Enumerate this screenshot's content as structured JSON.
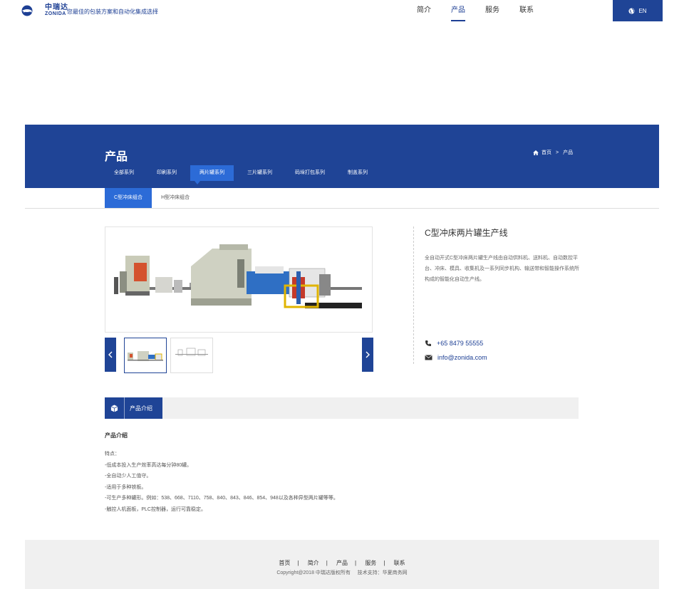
{
  "header": {
    "logo_cn": "中瑞达",
    "logo_en": "ZONIDA",
    "tagline": "您最佳的包装方案和自动化集成选择",
    "nav": [
      {
        "label": "简介",
        "active": false
      },
      {
        "label": "产品",
        "active": true
      },
      {
        "label": "服务",
        "active": false
      },
      {
        "label": "联系",
        "active": false
      }
    ],
    "lang_label": "EN"
  },
  "banner": {
    "title": "产品",
    "breadcrumb": {
      "home": "首页",
      "sep": ">",
      "current": "产品"
    },
    "categories": [
      {
        "label": "全部系列",
        "active": false
      },
      {
        "label": "印刷系列",
        "active": false
      },
      {
        "label": "两片罐系列",
        "active": true
      },
      {
        "label": "三片罐系列",
        "active": false
      },
      {
        "label": "码垛打包系列",
        "active": false
      },
      {
        "label": "制盖系列",
        "active": false
      }
    ]
  },
  "subtabs": [
    {
      "label": "C型冲床组合",
      "active": true
    },
    {
      "label": "H型冲床组合",
      "active": false
    }
  ],
  "product": {
    "title": "C型冲床两片罐生产线",
    "description": "全自动开式C型冲床两片罐生产线由自动供料机、送料机、自动数控平台、冲床、模具、收集机及一系列同步机构、输送带和智能操作系统所构成的智能化自动生产线。",
    "phone": "+65 8479 55555",
    "email": "info@zonida.com"
  },
  "intro": {
    "tab_label": "产品介绍",
    "heading": "产品介绍",
    "features": [
      "特点：",
      "-低成本投入生产效率高达每分钟80罐。",
      "-全自动少人工值守。",
      "-适用于多种铁板。",
      "-可生产多种罐形。例如：538、668、7110、758、840、843、846、854、948以及各种异型两片罐等等。",
      "-触控人机面板，PLC控制器，运行可靠稳定。"
    ]
  },
  "footer": {
    "links": [
      "首页",
      "简介",
      "产品",
      "服务",
      "联系"
    ],
    "copyright": "Copyright@2018 中瑞达版权所有",
    "support": "技术支持：华夏商务网"
  },
  "colors": {
    "brand": "#1f4496",
    "accent": "#2c6bd7"
  }
}
